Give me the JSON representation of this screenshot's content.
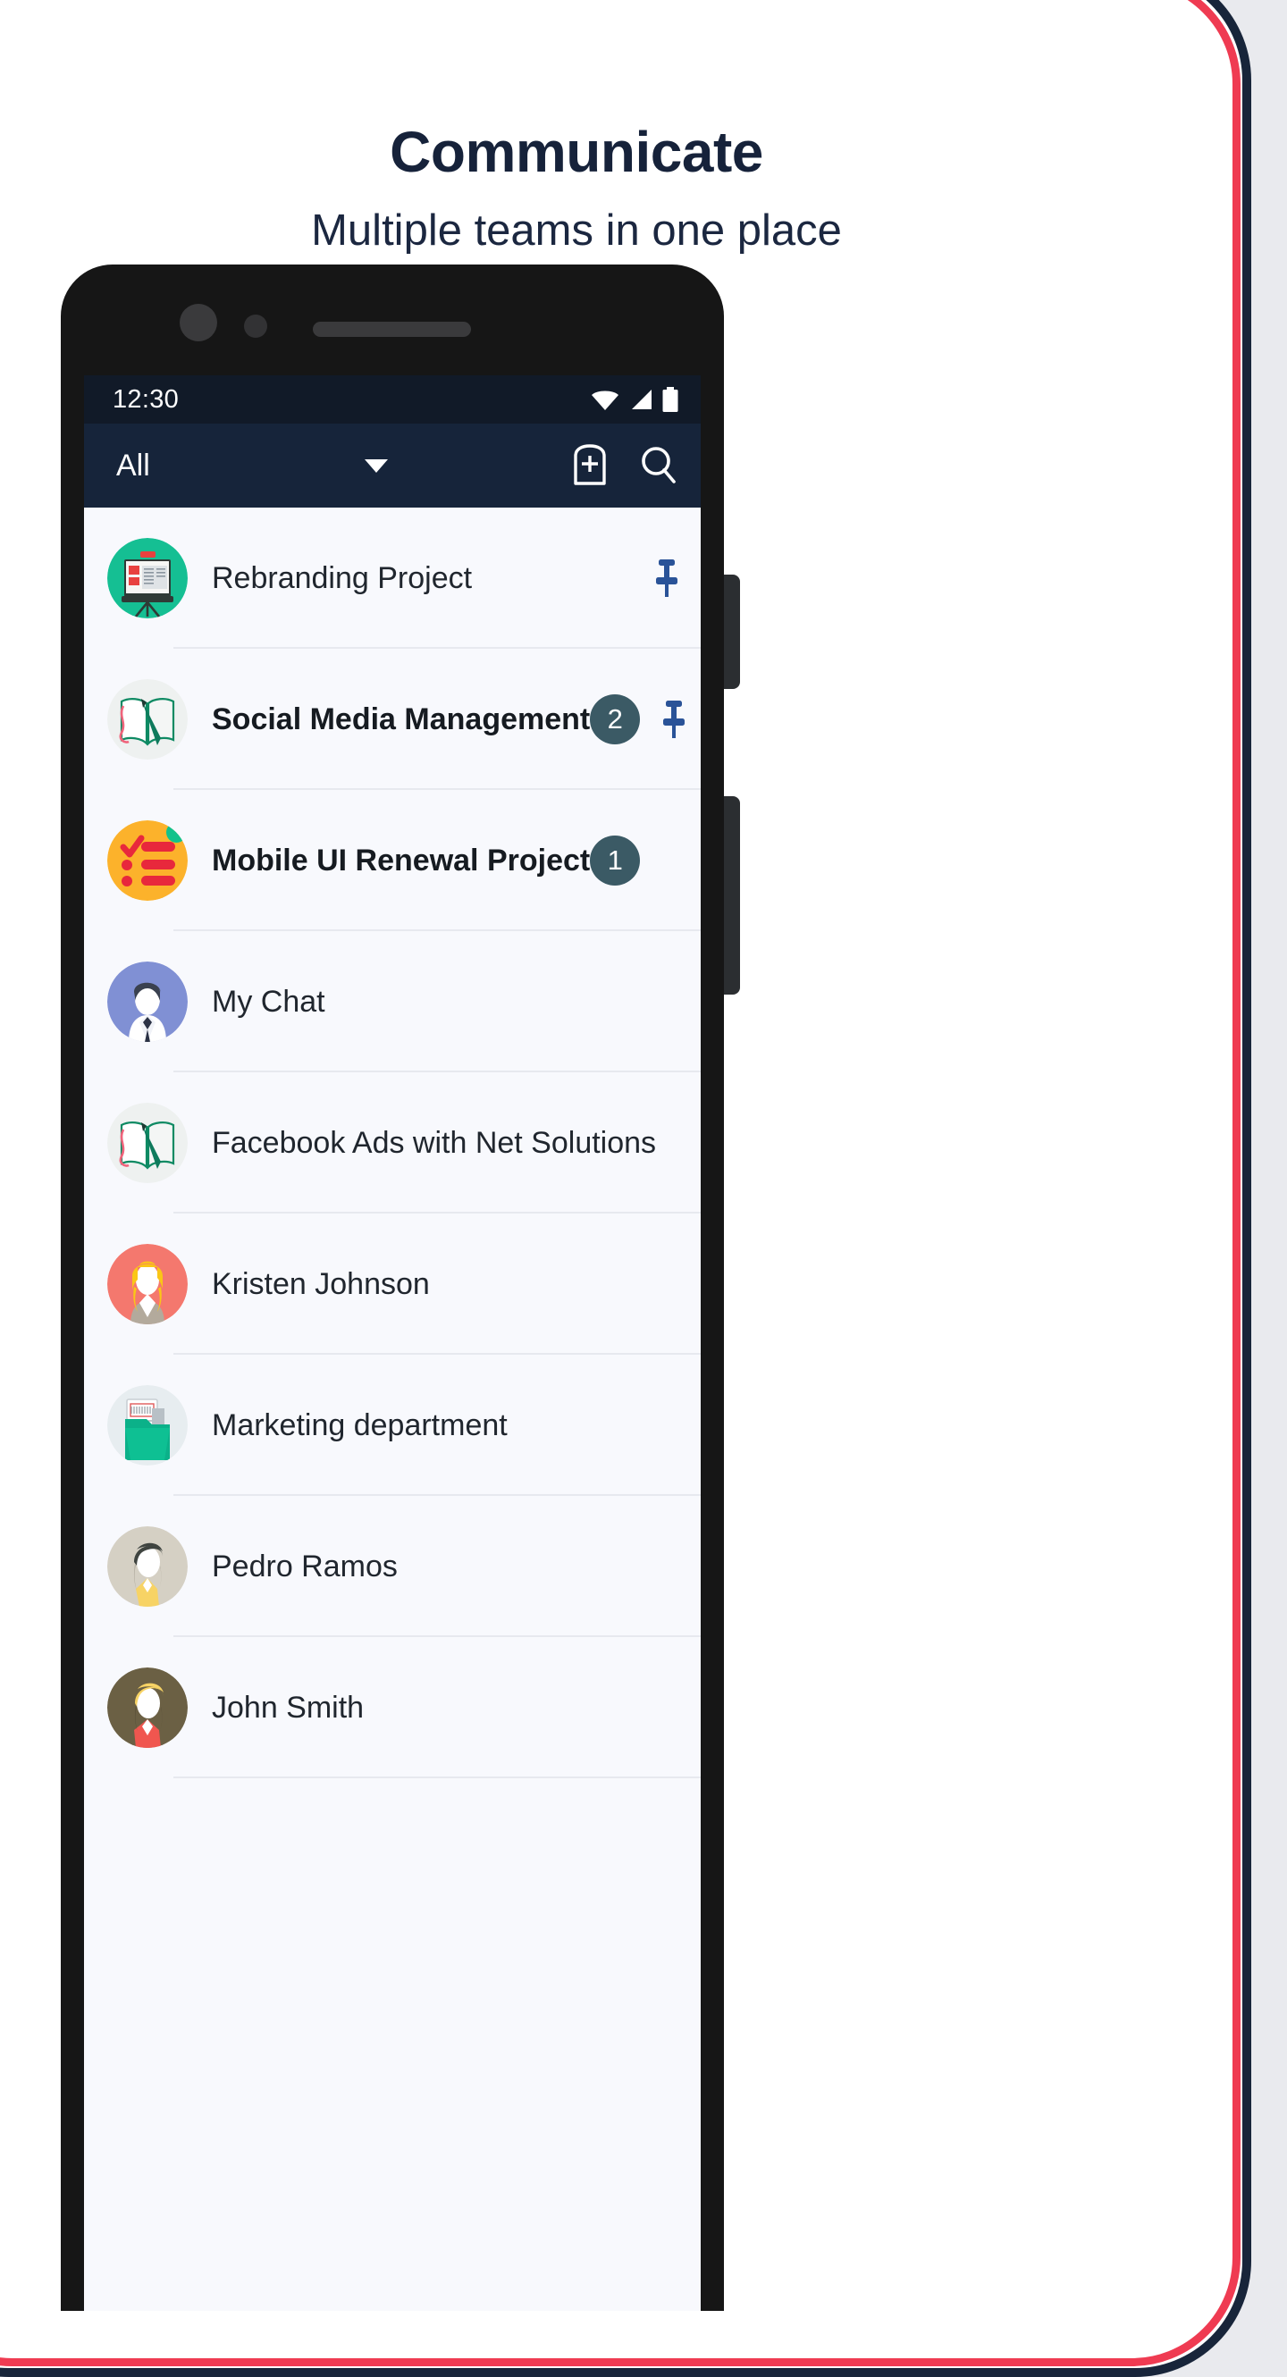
{
  "promo": {
    "headline": "Communicate",
    "subheadline": "Multiple teams in one place",
    "colors": {
      "card_border_dark": "#18253a",
      "card_border_red": "#ef3b52",
      "page_background": "#e9eaee",
      "heading_color": "#16223a"
    }
  },
  "phone": {
    "frame_color": "#161616",
    "icons": {
      "front_camera": "front-camera-icon",
      "sensor": "sensor-icon",
      "speaker": "speaker-grille-icon",
      "side_button_1": "volume-button",
      "side_button_2": "power-button"
    }
  },
  "statusbar": {
    "time": "12:30",
    "background": "#111a28",
    "icons": [
      "wifi-icon",
      "cellular-signal-icon",
      "battery-icon"
    ]
  },
  "appbar": {
    "background": "#16243a",
    "filter_label": "All",
    "filter_caret": "chevron-down-icon",
    "actions": [
      {
        "name": "new-chat-icon",
        "label": "New chat"
      },
      {
        "name": "search-icon",
        "label": "Search"
      }
    ]
  },
  "chat_list": {
    "badge_color": "#3b5a65",
    "pin_color": "#2a5398",
    "rows": [
      {
        "title": "Rebranding Project",
        "avatar": "presentation-board-avatar",
        "unread": false,
        "badge": "",
        "pinned": true,
        "online": false
      },
      {
        "title": "Social Media Management",
        "avatar": "open-book-pen-avatar",
        "unread": true,
        "badge": "2",
        "pinned": true,
        "online": false
      },
      {
        "title": "Mobile UI Renewal Project",
        "avatar": "checklist-avatar",
        "unread": true,
        "badge": "1",
        "pinned": false,
        "online": true
      },
      {
        "title": "My Chat",
        "avatar": "man-suit-avatar",
        "unread": false,
        "badge": "",
        "pinned": false,
        "online": false
      },
      {
        "title": "Facebook Ads with Net Solutions",
        "avatar": "open-book-pen-avatar",
        "unread": false,
        "badge": "",
        "pinned": false,
        "online": false
      },
      {
        "title": "Kristen Johnson",
        "avatar": "blonde-woman-avatar",
        "unread": false,
        "badge": "",
        "pinned": false,
        "online": false
      },
      {
        "title": "Marketing department",
        "avatar": "folder-documents-avatar",
        "unread": false,
        "badge": "",
        "pinned": false,
        "online": false
      },
      {
        "title": "Pedro Ramos",
        "avatar": "dark-hair-man-avatar",
        "unread": false,
        "badge": "",
        "pinned": false,
        "online": false
      },
      {
        "title": "John Smith",
        "avatar": "blonde-man-red-shirt-avatar",
        "unread": false,
        "badge": "",
        "pinned": false,
        "online": false
      }
    ]
  }
}
